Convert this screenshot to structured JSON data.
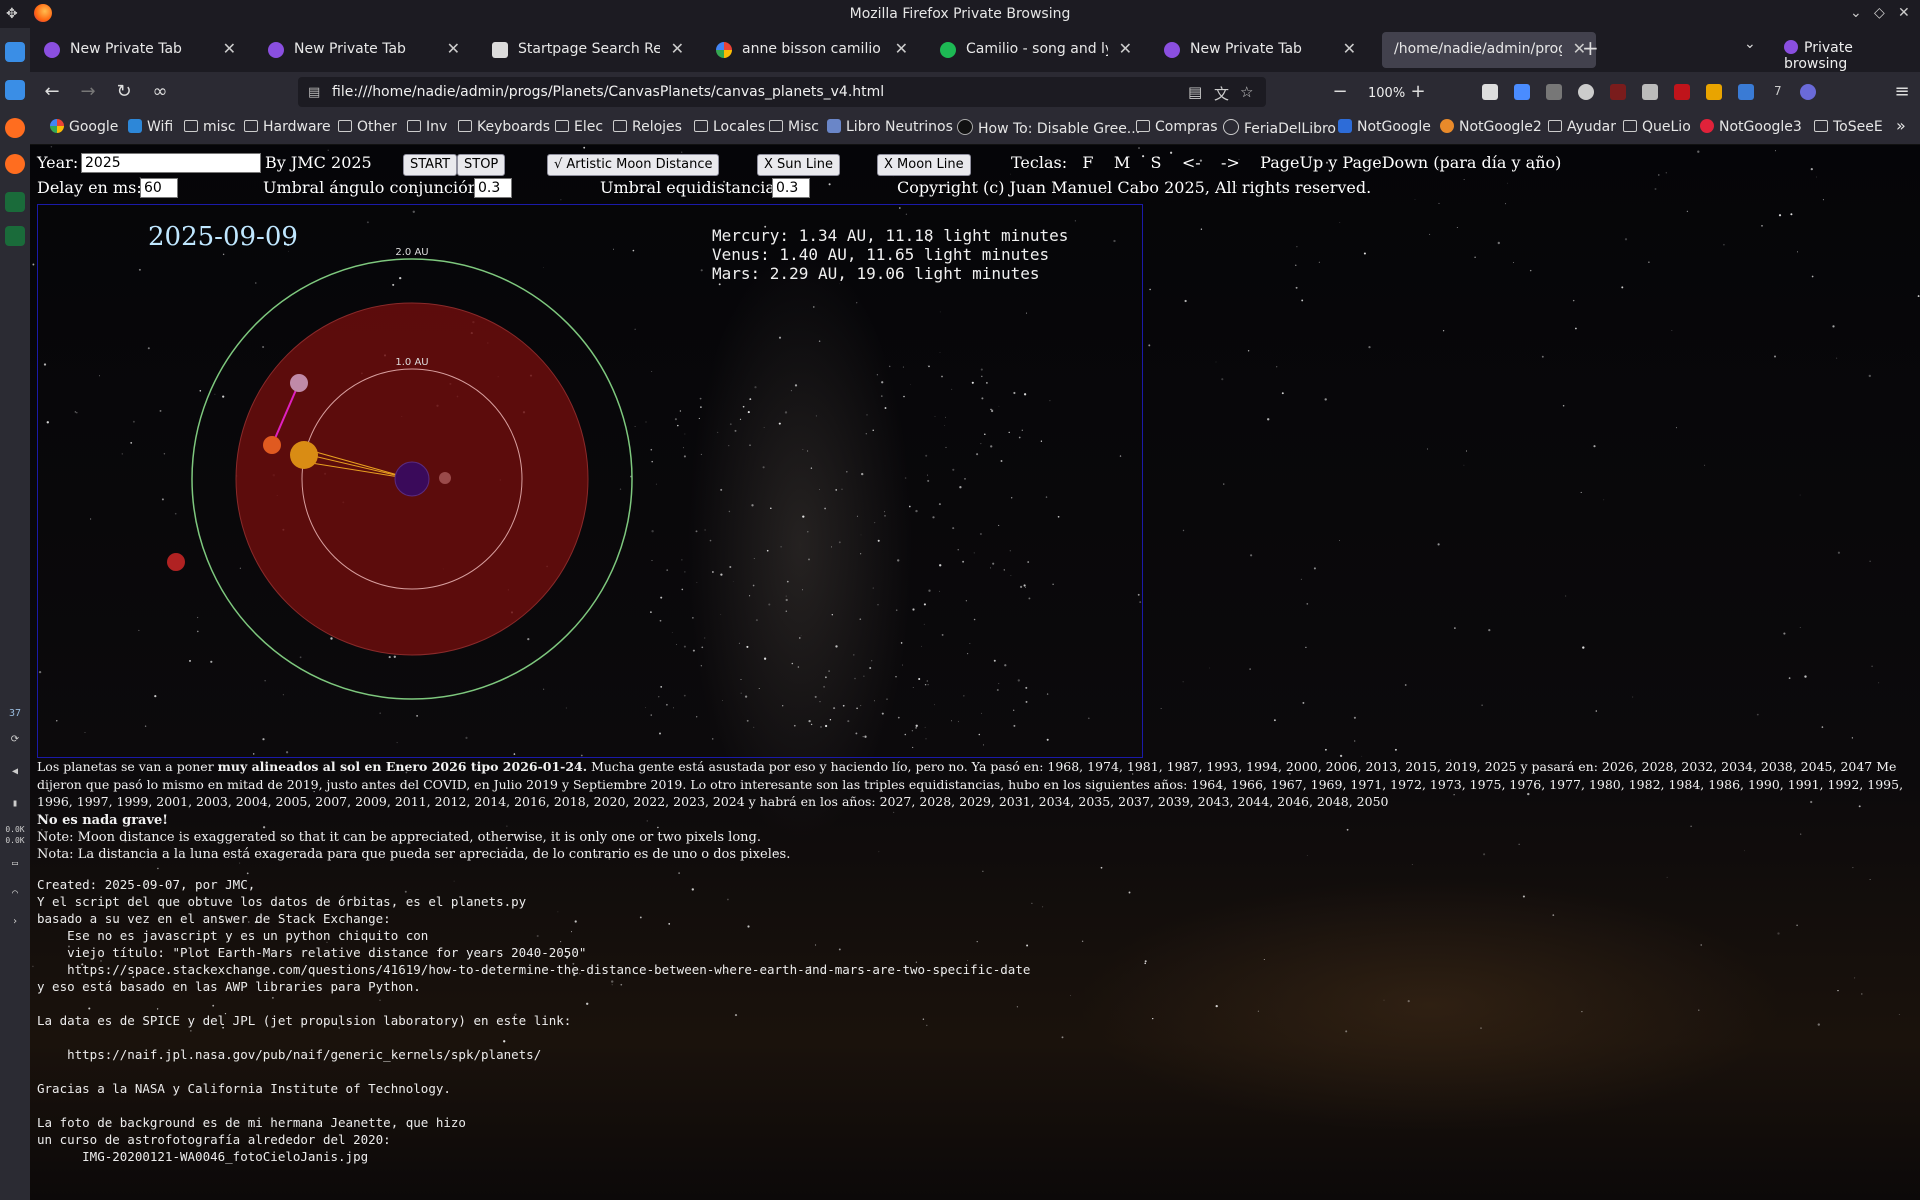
{
  "window": {
    "title": "Mozilla Firefox Private Browsing"
  },
  "tabs": [
    {
      "label": "New Private Tab",
      "icon": "private-mask-icon"
    },
    {
      "label": "New Private Tab",
      "icon": "private-mask-icon"
    },
    {
      "label": "Startpage Search Results",
      "icon": "startpage-icon"
    },
    {
      "label": "anne bisson camilio - Busc",
      "icon": "google-icon"
    },
    {
      "label": "Camilio - song and lyrics b",
      "icon": "spotify-icon"
    },
    {
      "label": "New Private Tab",
      "icon": "private-mask-icon"
    },
    {
      "label": "/home/nadie/admin/progs/Pl",
      "icon": "",
      "active": true
    }
  ],
  "private_label": "Private browsing",
  "url": "file:///home/nadie/admin/progs/Planets/CanvasPlanets/canvas_planets_v4.html",
  "zoom": "100%",
  "ext_badge": "7",
  "bookmarks": [
    {
      "label": "Google",
      "type": "site"
    },
    {
      "label": "Wifi",
      "type": "site"
    },
    {
      "label": "misc",
      "type": "folder"
    },
    {
      "label": "Hardware",
      "type": "folder"
    },
    {
      "label": "Other",
      "type": "folder"
    },
    {
      "label": "Inv",
      "type": "folder"
    },
    {
      "label": "Keyboards",
      "type": "folder"
    },
    {
      "label": "Elec",
      "type": "folder"
    },
    {
      "label": "Relojes",
      "type": "folder"
    },
    {
      "label": "Locales",
      "type": "folder"
    },
    {
      "label": "Misc",
      "type": "folder"
    },
    {
      "label": "Libro Neutrinos",
      "type": "site"
    },
    {
      "label": "How To: Disable Gree...",
      "type": "site"
    },
    {
      "label": "Compras",
      "type": "folder"
    },
    {
      "label": "FeriaDelLibro",
      "type": "site"
    },
    {
      "label": "NotGoogle",
      "type": "site"
    },
    {
      "label": "NotGoogle2",
      "type": "site"
    },
    {
      "label": "Ayudar",
      "type": "folder"
    },
    {
      "label": "QueLio",
      "type": "folder"
    },
    {
      "label": "NotGoogle3",
      "type": "site"
    },
    {
      "label": "ToSeeE",
      "type": "folder"
    }
  ],
  "dock": {
    "number": "37",
    "net_up": "0.0K",
    "net_down": "0.0K"
  },
  "page": {
    "year_label": "Year:",
    "year_value": "2025",
    "by_label": "By JMC 2025",
    "start_label": "START",
    "stop_label": "STOP",
    "moon_dist_label": "√ Artistic Moon Distance",
    "sun_line_label": "X Sun Line",
    "moon_line_label": "X Moon Line",
    "keys_label": "Teclas:   F    M    S    <-    ->    PageUp y PageDown (para día y año)",
    "delay_label": "Delay en ms:",
    "delay_value": "60",
    "angle_label": "Umbral ángulo conjunción:",
    "angle_value": "0.3",
    "equi_label": "Umbral equidistancia:",
    "equi_value": "0.3",
    "copyright": "Copyright (c) Juan Manuel Cabo 2025, All rights reserved."
  },
  "sim": {
    "date": "2025-09-09",
    "ring_outer_label": "2.0 AU",
    "ring_inner_label": "1.0 AU",
    "distances": [
      "Mercury: 1.34 AU, 11.18 light minutes",
      "Venus: 1.40 AU, 11.65 light minutes",
      "Mars: 2.29 AU, 19.06 light minutes"
    ]
  },
  "text": {
    "p1_a": "Los planetas se van a poner ",
    "p1_b": "muy alineados al sol en Enero 2026 tipo 2026-01-24.",
    "p1_c": " Mucha gente está asustada por eso y haciendo lío, pero no. Ya pasó en: 1968, 1974, 1981, 1987, 1993, 1994, 2000, 2006, 2013, 2015, 2019, 2025 y pasará en: 2026, 2028, 2032, 2034, 2038, 2045, 2047 Me dijeron que pasó lo mismo en mitad de 2019, justo antes del COVID, en Julio 2019 y Septiembre 2019. Lo otro interesante son las triples equidistancias, hubo en los siguientes años: 1964, 1966, 1967, 1969, 1971, 1972, 1973, 1975, 1976, 1977, 1980, 1982, 1984, 1986, 1990, 1991, 1992, 1995, 1996, 1997, 1999, 2001, 2003, 2004, 2005, 2007, 2009, 2011, 2012, 2014, 2016, 2018, 2020, 2022, 2023, 2024 y habrá en los años: 2027, 2028, 2029, 2031, 2034, 2035, 2037, 2039, 2043, 2044, 2046, 2048, 2050",
    "bold_line": "No es nada grave!",
    "note_en": "Note: Moon distance is exaggerated so that it can be appreciated, otherwise, it is only one or two pixels long.",
    "note_es": "Nota: La distancia a la luna está exagerada para que pueda ser apreciada, de lo contrario es de uno o dos pixeles.",
    "mono": [
      "Created: 2025-09-07, por JMC,",
      "Y el script del que obtuve los datos de órbitas, es el planets.py",
      "basado a su vez en el answer de Stack Exchange:",
      "    Ese no es javascript y es un python chiquito con",
      "    viejo título: \"Plot Earth-Mars relative distance for years 2040-2050\"",
      "    https://space.stackexchange.com/questions/41619/how-to-determine-the-distance-between-where-earth-and-mars-are-two-specific-date",
      "y eso está basado en las AWP libraries para Python.",
      "",
      "La data es de SPICE y del JPL (jet propulsion laboratory) en este link:",
      "",
      "    https://naif.jpl.nasa.gov/pub/naif/generic_kernels/spk/planets/",
      "",
      "Gracias a la NASA y California Institute of Technology.",
      "",
      "La foto de background es de mi hermana Jeanette, que hizo",
      "un curso de astrofotografía alrededor del 2020:",
      "      IMG-20200121-WA0046_fotoCieloJanis.jpg"
    ]
  },
  "colors": {
    "ring_outer": "#7ec87e",
    "ring_disc": "#6b0d0d",
    "sun": "#3a0a5a",
    "earth": "#d98c14",
    "venus": "#e05a20",
    "moon": "#c08aa8",
    "mars": "#b02222",
    "mercury": "#9a4a4a",
    "date_text": "#bfe7ff"
  }
}
